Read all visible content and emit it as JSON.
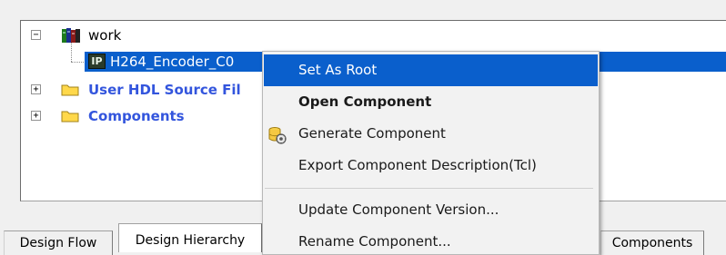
{
  "tree": {
    "library": {
      "label": "work",
      "expander": "−",
      "icon": "library-books-icon"
    },
    "component": {
      "label": "H264_Encoder_C0",
      "badge": "IP",
      "icon": "ip-core-icon"
    },
    "folders": [
      {
        "label": "User HDL Source Fil",
        "expander": "+",
        "icon": "folder-icon"
      },
      {
        "label": "Components",
        "expander": "+",
        "icon": "folder-icon"
      }
    ]
  },
  "context_menu": {
    "items": [
      {
        "label": "Set As Root",
        "highlighted": true
      },
      {
        "label": "Open Component",
        "bold": true
      },
      {
        "label": "Generate Component",
        "icon": "generate-component-icon"
      },
      {
        "label": "Export Component Description(Tcl)"
      },
      {
        "label": "Update Component Version..."
      },
      {
        "label": "Rename Component..."
      }
    ]
  },
  "tabs": [
    {
      "label": "Design Flow",
      "active": false
    },
    {
      "label": "Design Hierarchy",
      "active": true
    },
    {
      "label": "Components",
      "active": false
    }
  ],
  "colors": {
    "selection": "#0a5fcc",
    "folder_label": "#3355dd",
    "folder_fill": "#ffd84a"
  }
}
